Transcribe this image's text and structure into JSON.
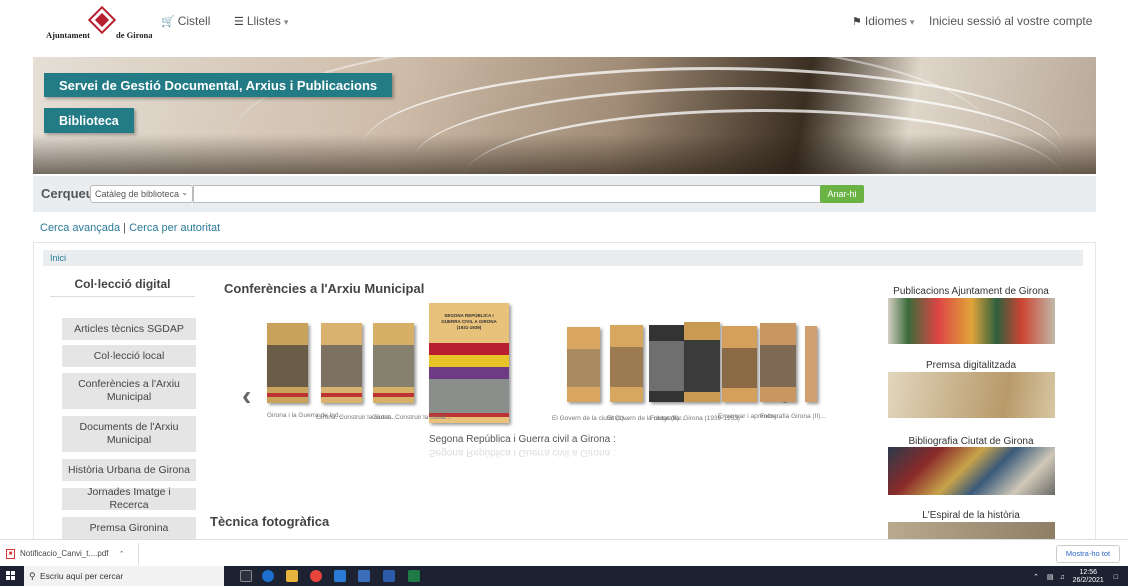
{
  "logo": {
    "left_text": "Ajuntament",
    "right_text": "de Girona"
  },
  "nav": {
    "cart": "Cistell",
    "lists": "Llistes",
    "languages": "Idiomes",
    "login": "Inicieu sessió al vostre compte"
  },
  "banner": {
    "title": "Servei de Gestió Documental, Arxius i Publicacions",
    "subtitle": "Biblioteca"
  },
  "search": {
    "label": "Cerqueu",
    "catalog_option": "Catàleg de biblioteca",
    "query": "",
    "button": "Anar-hi"
  },
  "links": {
    "advanced": "Cerca avançada",
    "separator": "|",
    "authority": "Cerca per autoritat"
  },
  "breadcrumb": "Inici",
  "sidebar": {
    "title": "Col·lecció digital",
    "items": [
      "Articles tècnics SGDAP",
      "Col·lecció local",
      "Conferències a l'Arxiu Municipal",
      "Documents de l'Arxiu Municipal",
      "Història Urbana de Girona",
      "Jornades Imatge i Recerca",
      "Premsa Gironina"
    ]
  },
  "sections": {
    "first": "Conferències a l'Arxiu Municipal",
    "second": "Tècnica fotogràfica"
  },
  "carousel": {
    "featured_caption": "Segona República i Guerra civil a Girona :",
    "featured_cover_text": "SEGONA REPÚBLICA I GUERRA CIVIL A GIRONA (1931-1939)",
    "captions": [
      "Girona i la Guerra de Ind...",
      "Girona. Construir la ciutat...",
      "Girona. Construir la ciutat...",
      "El Govern de la ciutat (1)...",
      "El Govern de la ciutat (II)...",
      "Fotografiar Girona (1939-1953)",
      "Ensenyar i aprendre...",
      "Fotografia Girona (II)..."
    ]
  },
  "right_panel": [
    "Publicacions Ajuntament de Girona",
    "Premsa digitalitzada",
    "Bibliografia Ciutat de Girona",
    "L'Espiral de la història"
  ],
  "downloads": {
    "file": "Notificacio_Canvi_t....pdf",
    "show_all": "Mostra-ho tot"
  },
  "taskbar": {
    "search_placeholder": "Escriu aquí per cercar",
    "time": "12:56",
    "date": "26/2/2021"
  },
  "colors": {
    "accent": "#237b86",
    "go_button": "#6ab344",
    "link": "#2b7a99"
  }
}
